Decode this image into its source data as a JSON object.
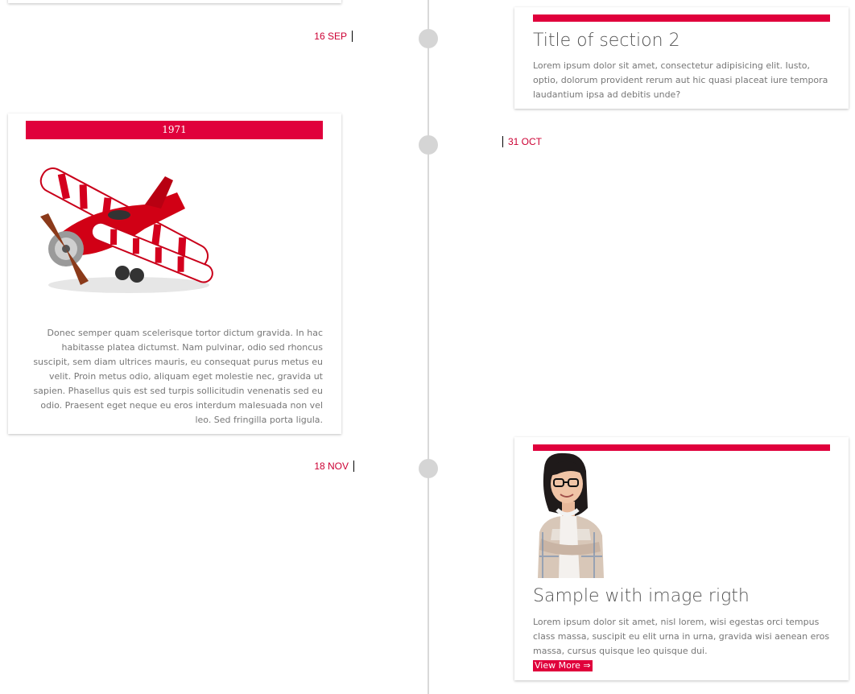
{
  "timeline": {
    "events": [
      {
        "date": "16 SEP",
        "title": "Title of section 2",
        "text": "Lorem ipsum dolor sit amet, consectetur adipisicing elit. Iusto, optio, dolorum provident rerum aut hic quasi placeat iure tempora laudantium ipsa ad debitis unde?"
      },
      {
        "date": "31 OCT",
        "year_label": "1971",
        "text": "Donec semper quam scelerisque tortor dictum gravida. In hac habitasse platea dictumst. Nam pulvinar, odio sed rhoncus suscipit, sem diam ultrices mauris, eu consequat purus metus eu velit. Proin metus odio, aliquam eget molestie nec, gravida ut sapien. Phasellus quis est sed turpis sollicitudin venenatis sed eu odio. Praesent eget neque eu eros interdum malesuada non vel leo. Sed fringilla porta ligula."
      },
      {
        "date": "18 NOV",
        "title": "Sample with image rigth",
        "text": "Lorem ipsum dolor sit amet, nisl lorem, wisi egestas orci tempus class massa, suscipit eu elit urna in urna, gravida wisi aenean eros massa, cursus quisque leo quisque dui.",
        "link": "View More ⇒"
      }
    ]
  },
  "colors": {
    "accent": "#e0003c",
    "line": "#d9d9d9",
    "dot": "#d5d5d5"
  },
  "images": {
    "biplane": "red-biplane-image",
    "woman": "woman-with-glasses-image"
  }
}
